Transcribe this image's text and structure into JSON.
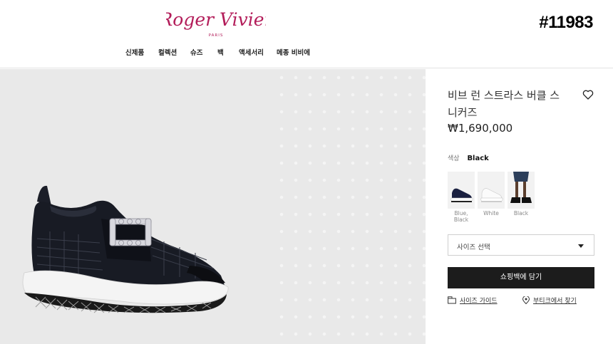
{
  "brand": {
    "logo_text": "Roger Vivier",
    "logo_subtext": "PARIS",
    "logo_color": "#b31d5a"
  },
  "watermark": "#11983",
  "nav": [
    "신제품",
    "컬렉션",
    "슈즈",
    "백",
    "액세서리",
    "메종 비비에"
  ],
  "product": {
    "title_line1": "비브 런 스트라스 버클 스",
    "title_line2": "니커즈",
    "price": "₩1,690,000",
    "color_label": "색상",
    "color_value": "Black",
    "swatches": [
      {
        "label_line1": "Blue,",
        "label_line2": "Black",
        "selected": false
      },
      {
        "label_line1": "White",
        "label_line2": "",
        "selected": false
      },
      {
        "label_line1": "Black",
        "label_line2": "",
        "selected": true
      }
    ],
    "size_placeholder": "사이즈 선택",
    "add_to_cart": "쇼핑백에 담기",
    "size_guide": "사이즈 가이드",
    "find_boutique": "부티크에서 찾기"
  },
  "icons": {
    "wishlist": "heart-outline-icon",
    "size_guide": "ruler-icon",
    "boutique": "location-pin-icon",
    "select": "chevron-down-icon"
  },
  "colors": {
    "accent": "#b0203a",
    "button": "#1c1c1c",
    "image_bg": "#e9e9e9"
  }
}
